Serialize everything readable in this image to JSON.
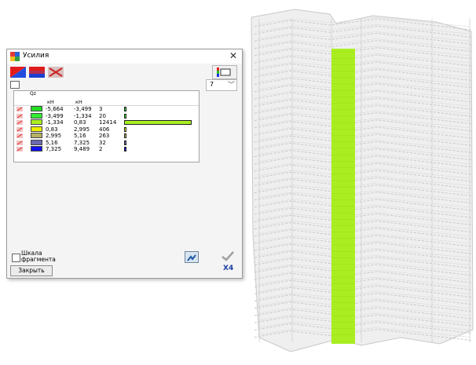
{
  "window": {
    "title": "Усилия",
    "close_glyph": "✕"
  },
  "toolbar": {
    "icons": [
      "color-scheme-icon",
      "colored-bands-icon",
      "disable-scale-icon"
    ],
    "right_icon": "legend-settings-icon"
  },
  "intervals_combo": {
    "value": "7",
    "arrow": "﹀"
  },
  "table": {
    "quantity_label": "Qz",
    "unit_from": "кН",
    "unit_to": "кН",
    "rows": [
      {
        "color": "#22dd22",
        "from": "-5,664",
        "to": "-3,499",
        "count": "3",
        "share": 0.0002
      },
      {
        "color": "#33ee33",
        "from": "-3,499",
        "to": "-1,334",
        "count": "20",
        "share": 0.0016
      },
      {
        "color": "#aaee22",
        "from": "-1,334",
        "to": "0,83",
        "count": "12414",
        "share": 1.0
      },
      {
        "color": "#eeee00",
        "from": "0,83",
        "to": "2,995",
        "count": "406",
        "share": 0.033
      },
      {
        "color": "#b5b066",
        "from": "2,995",
        "to": "5,16",
        "count": "263",
        "share": 0.021
      },
      {
        "color": "#6b6bb0",
        "from": "5,16",
        "to": "7,325",
        "count": "32",
        "share": 0.0026
      },
      {
        "color": "#1010ee",
        "from": "7,325",
        "to": "9,489",
        "count": "2",
        "share": 0.0002
      }
    ]
  },
  "scale_checkbox": {
    "label": "Шкала фрагмента",
    "checked": false
  },
  "close_button": {
    "label": "Закрыть"
  },
  "help_icon": {
    "label": "X4"
  },
  "model": {
    "highlight_color": "#aaee22",
    "wire_color": "#c8c8c8"
  }
}
